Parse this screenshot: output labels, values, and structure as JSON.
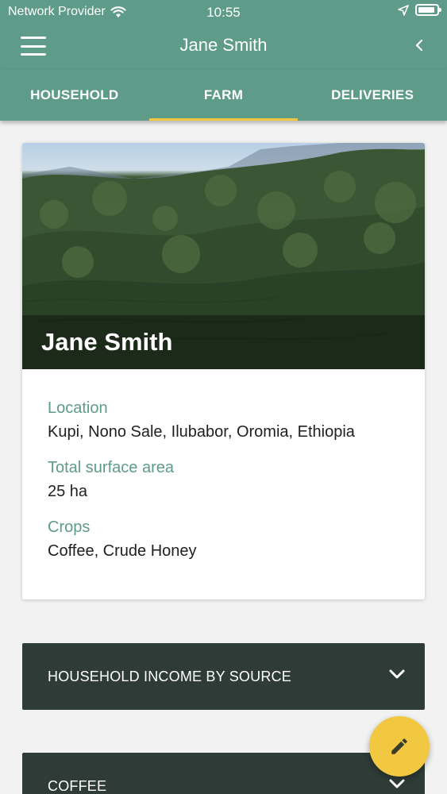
{
  "status_bar": {
    "carrier": "Network Provider",
    "time": "10:55",
    "icons": [
      "wifi-icon",
      "location-arrow-icon",
      "battery-icon"
    ]
  },
  "app_bar": {
    "title": "Jane Smith",
    "icons": [
      "menu-icon",
      "back-chevron-icon"
    ]
  },
  "tabs": [
    {
      "label": "HOUSEHOLD",
      "active": false
    },
    {
      "label": "FARM",
      "active": true
    },
    {
      "label": "DELIVERIES",
      "active": false
    }
  ],
  "farm_card": {
    "name": "Jane Smith",
    "fields": [
      {
        "label": "Location",
        "value": "Kupi, Nono Sale, Ilubabor, Oromia, Ethiopia"
      },
      {
        "label": "Total surface area",
        "value": "25 ha"
      },
      {
        "label": "Crops",
        "value": "Coffee, Crude Honey"
      }
    ]
  },
  "sections": [
    {
      "label": "HOUSEHOLD INCOME BY SOURCE",
      "icon": "chevron-down-icon"
    },
    {
      "label": "COFFEE",
      "icon": "chevron-down-icon"
    }
  ],
  "fab": {
    "icon": "pencil-icon"
  },
  "colors": {
    "primary": "#5e9b88",
    "accent": "#f2c842",
    "section_bg": "#2e3b36",
    "label": "#5e9b88"
  }
}
